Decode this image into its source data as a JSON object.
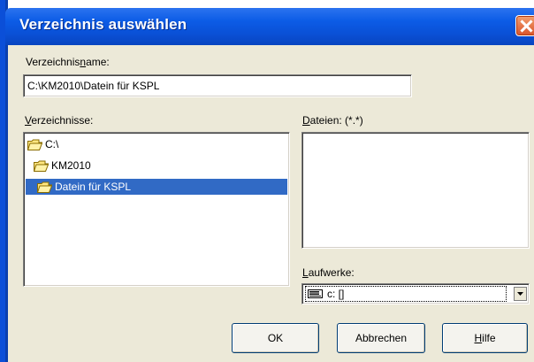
{
  "window": {
    "title": "Verzeichnis auswählen"
  },
  "directory_name": {
    "label_pre": "Verzeichnis",
    "label_mnemonic": "n",
    "label_post": "ame:",
    "value": "C:\\KM2010\\Datein für KSPL"
  },
  "directories": {
    "label_mnemonic": "V",
    "label_post": "erzeichnisse:",
    "items": [
      {
        "label": "C:\\",
        "selected": false
      },
      {
        "label": "KM2010",
        "selected": false
      },
      {
        "label": "Datein für KSPL",
        "selected": true
      }
    ]
  },
  "files": {
    "label_mnemonic": "D",
    "label_post": "ateien: (*.*)",
    "items": []
  },
  "drives": {
    "label_mnemonic": "L",
    "label_post": "aufwerke:",
    "selected": "c: []",
    "icon": "drive-icon"
  },
  "buttons": {
    "ok": "OK",
    "cancel": "Abbrechen",
    "help_mnemonic": "H",
    "help_post": "ilfe"
  },
  "colors": {
    "titlebar": "#0a50d6",
    "selection": "#316ac5",
    "dialog_bg": "#ece9d8",
    "close": "#d9532a"
  }
}
